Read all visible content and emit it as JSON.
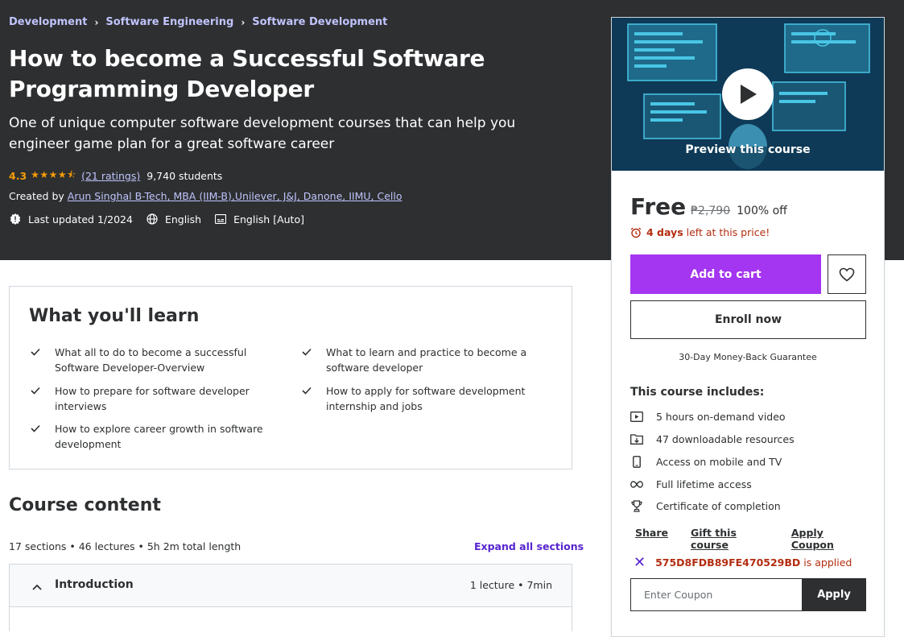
{
  "breadcrumb": [
    "Development",
    "Software Engineering",
    "Software Development"
  ],
  "course": {
    "title": "How to become a Successful Software Programming Developer",
    "subtitle": "One of unique computer software development courses that can help you engineer game plan for a great software career",
    "rating": "4.3",
    "stars": "★★★★⯪",
    "ratings_link": "(21 ratings)",
    "students": "9,740 students",
    "created_label": "Created by",
    "author": "Arun Singhal B-Tech, MBA (IIM-B),Unilever, J&J, Danone, IIMU, Cello",
    "last_updated": "Last updated 1/2024",
    "language": "English",
    "captions": "English [Auto]"
  },
  "learn": {
    "title": "What you'll learn",
    "items": [
      "What all to do to become a successful Software Developer-Overview",
      "What to learn and practice to become a software developer",
      "How to prepare for software developer interviews",
      "How to apply for software development internship and jobs",
      "How to explore career growth in software development"
    ]
  },
  "content": {
    "title": "Course content",
    "meta": "17 sections • 46 lectures • 5h 2m total length",
    "expand_label": "Expand all sections",
    "sections": [
      {
        "title": "Introduction",
        "meta": "1 lecture • 7min"
      }
    ]
  },
  "sidebar": {
    "preview_label": "Preview this course",
    "price": "Free",
    "original_price": "₱2,790",
    "discount": "100% off",
    "timer_days": "4 days",
    "timer_text": "left at this price!",
    "add_to_cart": "Add to cart",
    "enroll": "Enroll now",
    "guarantee": "30-Day Money-Back Guarantee",
    "includes_title": "This course includes:",
    "includes": [
      {
        "icon": "video-icon",
        "label": "5 hours on-demand video"
      },
      {
        "icon": "folder-download-icon",
        "label": "47 downloadable resources"
      },
      {
        "icon": "mobile-icon",
        "label": "Access on mobile and TV"
      },
      {
        "icon": "infinity-icon",
        "label": "Full lifetime access"
      },
      {
        "icon": "trophy-icon",
        "label": "Certificate of completion"
      }
    ],
    "share": "Share",
    "gift": "Gift this course",
    "apply_coupon": "Apply Coupon",
    "coupon_code": "575D8FDB89FE470529BD",
    "coupon_applied": "is applied",
    "coupon_placeholder": "Enter Coupon",
    "apply": "Apply"
  },
  "colors": {
    "hero_bg": "#2d2f31",
    "link_purple": "#c0c4fc",
    "accent_purple": "#a435f0",
    "star": "#f69c08",
    "alert_red": "#b32d0f"
  }
}
